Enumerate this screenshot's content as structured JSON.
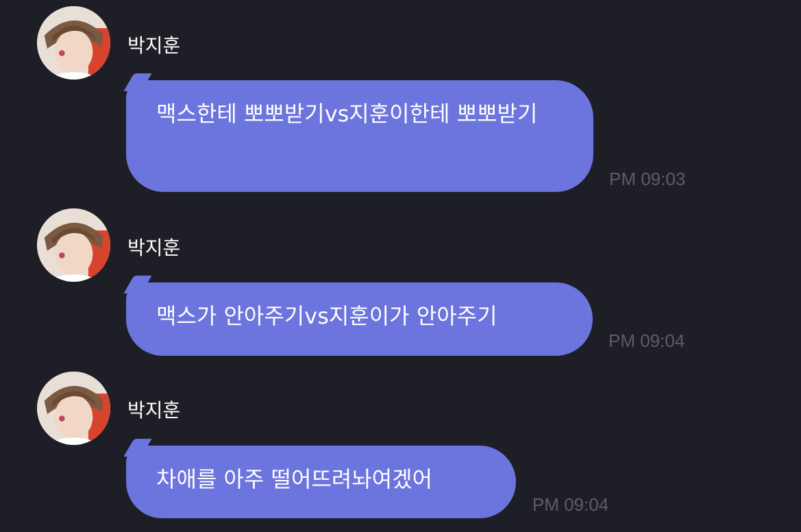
{
  "messages": [
    {
      "sender": "박지훈",
      "avatar_icon": "profile-photo-avatar",
      "text": "맥스한테 뽀뽀받기vs지훈이한테 뽀뽀받기",
      "time": "PM 09:03"
    },
    {
      "sender": "박지훈",
      "avatar_icon": "profile-photo-avatar",
      "text": "맥스가 안아주기vs지훈이가 안아주기",
      "time": "PM 09:04"
    },
    {
      "sender": "박지훈",
      "avatar_icon": "profile-photo-avatar",
      "text": "차애를 아주 떨어뜨려놔여겠어",
      "time": "PM 09:04"
    }
  ],
  "colors": {
    "background": "#1e1e26",
    "bubble": "#6c74dd",
    "timestamp": "#5d5d68"
  }
}
